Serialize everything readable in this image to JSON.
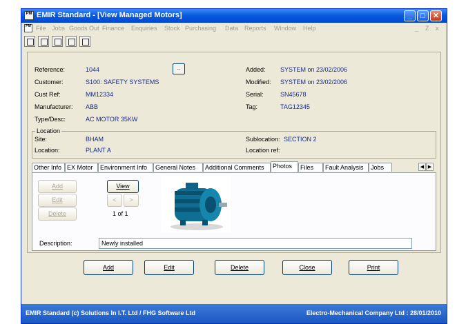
{
  "window": {
    "title": "EMIR Standard - [View Managed Motors]",
    "app_icon_text": "PM"
  },
  "menu": [
    "File",
    "Jobs",
    "Goods Out",
    "Finance",
    "Enquiries",
    "Stock",
    "Purchasing",
    "Data",
    "Reports",
    "Window",
    "Help"
  ],
  "mdi_controls": [
    "_",
    "Ζ",
    "x"
  ],
  "record": {
    "reference_label": "Reference:",
    "reference": "1044",
    "lookup_button": "..",
    "customer_label": "Customer:",
    "customer": "S100: SAFETY SYSTEMS",
    "custref_label": "Cust Ref:",
    "custref": "MM12334",
    "manufacturer_label": "Manufacturer:",
    "manufacturer": "ABB",
    "type_label": "Type/Desc:",
    "type": "AC MOTOR 35KW",
    "added_label": "Added:",
    "added": "SYSTEM on 23/02/2006",
    "modified_label": "Modified:",
    "modified": "SYSTEM on 23/02/2006",
    "serial_label": "Serial:",
    "serial": "SN45678",
    "tag_label": "Tag:",
    "tag": "TAG12345"
  },
  "location": {
    "group_title": "Location",
    "site_label": "Site:",
    "site": "BHAM",
    "location_label": "Location:",
    "location": "PLANT A",
    "sublocation_label": "Sublocation:",
    "sublocation": "SECTION 2",
    "locref_label": "Location ref:",
    "locref": ""
  },
  "tabs": [
    "Other Info",
    "EX Motor",
    "Environment Info",
    "General Notes",
    "Additional Comments",
    "Photos",
    "Files",
    "Fault Analysis",
    "Jobs"
  ],
  "active_tab": "Photos",
  "photos": {
    "add": "Add",
    "edit": "Edit",
    "delete": "Delete",
    "view": "View",
    "prev": "<",
    "next": ">",
    "counter": "1 of 1",
    "description_label": "Description:",
    "description": "Newly installed"
  },
  "actions": {
    "add": "Add",
    "edit": "Edit",
    "delete": "Delete",
    "close": "Close",
    "print": "Print"
  },
  "status": {
    "left": "EMIR Standard (c) Solutions In I.T. Ltd / FHG Software Ltd",
    "right": "Electro-Mechanical Company Ltd : 28/01/2010"
  }
}
